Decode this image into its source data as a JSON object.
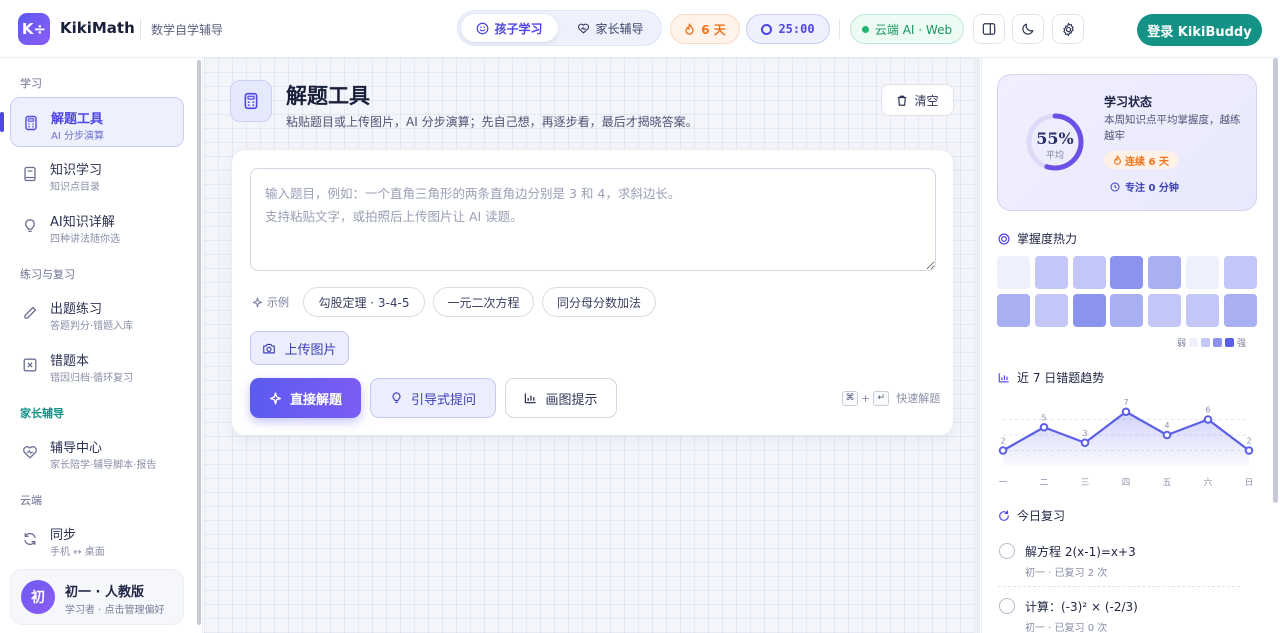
{
  "header": {
    "logo_glyph": "K÷",
    "app_name": "KikiMath",
    "app_subtitle": "数学自学辅导",
    "modes": [
      {
        "label": "孩子学习",
        "icon": "smile-icon",
        "active": true
      },
      {
        "label": "家长辅导",
        "icon": "heart-icon",
        "active": false
      }
    ],
    "streak_label": "6 天",
    "timer_label": "25:00",
    "cloud_status": "云端 AI · Web",
    "login_label": "登录 KikiBuddy",
    "colors": {
      "brand": "#4f46e5",
      "teal": "#159286",
      "orange": "#f0731c",
      "green": "#22b573"
    }
  },
  "sidebar": {
    "sections": [
      {
        "title": "学习",
        "items": [
          {
            "label": "解题工具",
            "sub": "AI 分步演算",
            "icon": "calculator-icon",
            "active": true
          },
          {
            "label": "知识学习",
            "sub": "知识点目录",
            "icon": "book-icon",
            "active": false
          },
          {
            "label": "AI知识详解",
            "sub": "四种讲法随你选",
            "icon": "lightbulb-icon",
            "active": false
          }
        ]
      },
      {
        "title": "练习与复习",
        "items": [
          {
            "label": "出题练习",
            "sub": "答题判分·错题入库",
            "icon": "pencil-icon",
            "active": false
          },
          {
            "label": "错题本",
            "sub": "错因归档·循环复习",
            "icon": "x-square-icon",
            "active": false
          }
        ]
      },
      {
        "title": "家长辅导",
        "items": [
          {
            "label": "辅导中心",
            "sub": "家长陪学·辅导脚本·报告",
            "icon": "heart-pulse-icon",
            "active": false
          }
        ]
      },
      {
        "title": "云端",
        "items": [
          {
            "label": "同步",
            "sub": "手机 ↔ 桌面",
            "icon": "sync-icon",
            "active": false
          }
        ]
      }
    ],
    "profile": {
      "avatar": "初",
      "name": "初一 · 人教版",
      "sub": "学习者 · 点击管理偏好"
    }
  },
  "main": {
    "title": "解题工具",
    "description": "粘贴题目或上传图片，AI 分步演算；先自己想，再逐步看，最后才揭晓答案。",
    "clear_label": "清空",
    "question": {
      "value": "",
      "placeholder": "输入题目，例如：一个直角三角形的两条直角边分别是 3 和 4，求斜边长。\n支持粘贴文字，或拍照后上传图片让 AI 读题。"
    },
    "examples_label": "示例",
    "examples": [
      "勾股定理 · 3-4-5",
      "一元二次方程",
      "同分母分数加法"
    ],
    "upload_label": "上传图片",
    "actions": {
      "solve": "直接解题",
      "guided": "引导式提问",
      "draw": "画图提示"
    },
    "shortcut": {
      "key1": "⌘",
      "plus": "+",
      "key2": "↵",
      "label": "快速解题"
    }
  },
  "right_panel": {
    "status": {
      "mastery_percent": 55,
      "mastery_label": "55%",
      "mastery_sub": "平均",
      "title": "学习状态",
      "description": "本周知识点平均掌握度，越练越牢",
      "streak": "连续 6 天",
      "focus": "专注 0 分钟"
    },
    "heatmap": {
      "title": "掌握度热力",
      "levels": [
        [
          1,
          2,
          2,
          4,
          3,
          1,
          2
        ],
        [
          3,
          2,
          4,
          3,
          2,
          2,
          3
        ]
      ],
      "palette": [
        "#eef0fd",
        "#c3c7f7",
        "#a9aff3",
        "#8c93ef",
        "#5b5ee8"
      ],
      "legend_low": "弱",
      "legend_high": "强"
    },
    "trend": {
      "title": "近 7 日错题趋势",
      "chart_data": {
        "type": "line",
        "categories": [
          "一",
          "二",
          "三",
          "四",
          "五",
          "六",
          "日"
        ],
        "values": [
          2,
          5,
          3,
          7,
          4,
          6,
          2
        ],
        "ylim": [
          0,
          8
        ]
      }
    },
    "review": {
      "title": "今日复习",
      "items": [
        {
          "question": "解方程 2(x-1)=x+3",
          "meta": "初一 · 已复习 2 次"
        },
        {
          "question": "计算：(-3)² × (-2/3)",
          "meta": "初一 · 已复习 0 次"
        }
      ]
    }
  }
}
